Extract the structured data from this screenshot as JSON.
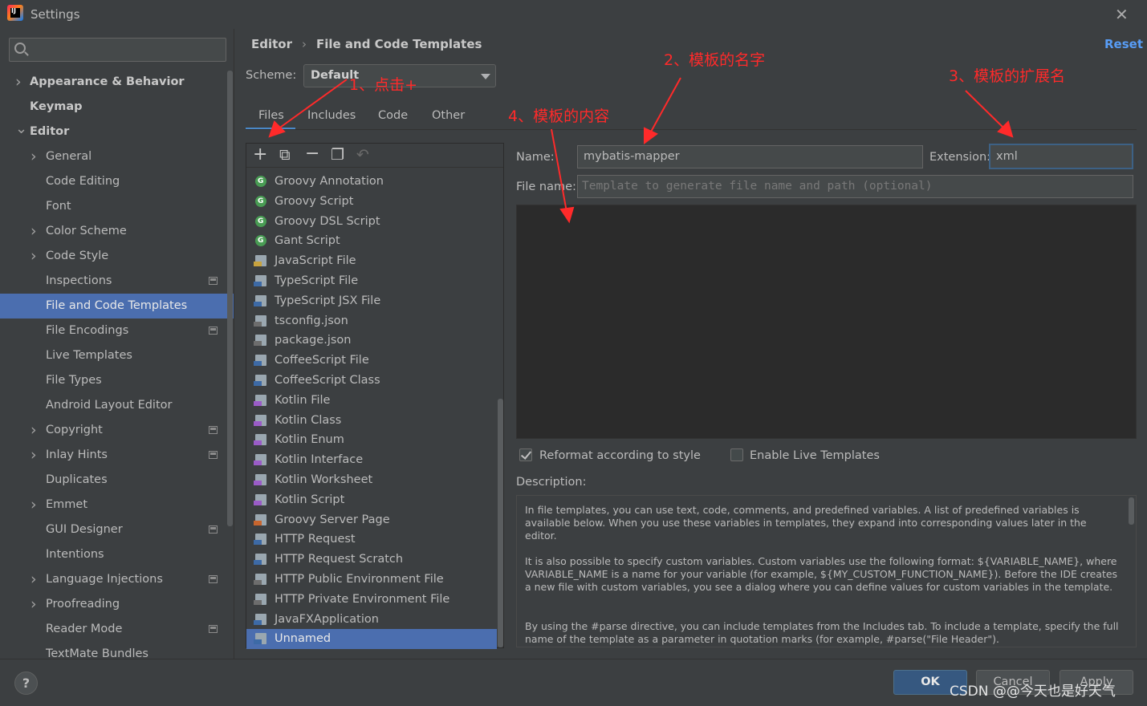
{
  "window": {
    "title": "Settings",
    "close_icon": "close-icon"
  },
  "search": {
    "placeholder": ""
  },
  "sidebar": {
    "items": [
      {
        "label": "Appearance & Behavior",
        "chevron": ">",
        "bold": true
      },
      {
        "label": "Keymap",
        "chevron": "",
        "bold": true
      },
      {
        "label": "Editor",
        "chevron": "v",
        "bold": true
      },
      {
        "label": "General",
        "chevron": ">"
      },
      {
        "label": "Code Editing",
        "chevron": ""
      },
      {
        "label": "Font",
        "chevron": ""
      },
      {
        "label": "Color Scheme",
        "chevron": ">"
      },
      {
        "label": "Code Style",
        "chevron": ">"
      },
      {
        "label": "Inspections",
        "chevron": "",
        "mark": true
      },
      {
        "label": "File and Code Templates",
        "chevron": "",
        "selected": true
      },
      {
        "label": "File Encodings",
        "chevron": "",
        "mark": true
      },
      {
        "label": "Live Templates",
        "chevron": ""
      },
      {
        "label": "File Types",
        "chevron": ""
      },
      {
        "label": "Android Layout Editor",
        "chevron": ""
      },
      {
        "label": "Copyright",
        "chevron": ">",
        "mark": true
      },
      {
        "label": "Inlay Hints",
        "chevron": ">",
        "mark": true
      },
      {
        "label": "Duplicates",
        "chevron": ""
      },
      {
        "label": "Emmet",
        "chevron": ">"
      },
      {
        "label": "GUI Designer",
        "chevron": "",
        "mark": true
      },
      {
        "label": "Intentions",
        "chevron": ""
      },
      {
        "label": "Language Injections",
        "chevron": ">",
        "mark": true
      },
      {
        "label": "Proofreading",
        "chevron": ">"
      },
      {
        "label": "Reader Mode",
        "chevron": "",
        "mark": true
      },
      {
        "label": "TextMate Bundles",
        "chevron": ""
      }
    ]
  },
  "breadcrumb": {
    "parent": "Editor",
    "current": "File and Code Templates",
    "separator": "›"
  },
  "reset_label": "Reset",
  "scheme": {
    "label": "Scheme:",
    "value": "Default"
  },
  "tabs": [
    {
      "label": "Files",
      "active": true
    },
    {
      "label": "Includes"
    },
    {
      "label": "Code"
    },
    {
      "label": "Other"
    }
  ],
  "toolbar": {
    "add": "+",
    "copy": "⧉",
    "remove": "−",
    "duplicate": "❐",
    "revert": "↶"
  },
  "templates": [
    {
      "label": "Groovy Annotation",
      "icon": "groovy-icon"
    },
    {
      "label": "Groovy Script",
      "icon": "groovy-icon"
    },
    {
      "label": "Groovy DSL Script",
      "icon": "groovy-icon"
    },
    {
      "label": "Gant Script",
      "icon": "groovy-icon"
    },
    {
      "label": "JavaScript File",
      "icon": "js-file-icon",
      "color": "#c7a23e"
    },
    {
      "label": "TypeScript File",
      "icon": "ts-file-icon",
      "color": "#3d6aa6"
    },
    {
      "label": "TypeScript JSX File",
      "icon": "tsx-file-icon",
      "color": "#3d6aa6"
    },
    {
      "label": "tsconfig.json",
      "icon": "json-file-icon",
      "color": "#6d6d6d"
    },
    {
      "label": "package.json",
      "icon": "json-file-icon",
      "color": "#6d6d6d"
    },
    {
      "label": "CoffeeScript File",
      "icon": "coffee-file-icon",
      "color": "#3d6aa6"
    },
    {
      "label": "CoffeeScript Class",
      "icon": "coffee-file-icon",
      "color": "#3d6aa6"
    },
    {
      "label": "Kotlin File",
      "icon": "kotlin-file-icon",
      "color": "#9a5cc7"
    },
    {
      "label": "Kotlin Class",
      "icon": "kotlin-file-icon",
      "color": "#9a5cc7"
    },
    {
      "label": "Kotlin Enum",
      "icon": "kotlin-file-icon",
      "color": "#9a5cc7"
    },
    {
      "label": "Kotlin Interface",
      "icon": "kotlin-file-icon",
      "color": "#9a5cc7"
    },
    {
      "label": "Kotlin Worksheet",
      "icon": "kotlin-file-icon",
      "color": "#9a5cc7"
    },
    {
      "label": "Kotlin Script",
      "icon": "kotlin-file-icon",
      "color": "#9a5cc7"
    },
    {
      "label": "Groovy Server Page",
      "icon": "gsp-file-icon",
      "color": "#c7652e"
    },
    {
      "label": "HTTP Request",
      "icon": "api-file-icon",
      "color": "#3d6aa6"
    },
    {
      "label": "HTTP Request Scratch",
      "icon": "api-file-icon",
      "color": "#3d6aa6"
    },
    {
      "label": "HTTP Public Environment File",
      "icon": "json-file-icon",
      "color": "#6d6d6d"
    },
    {
      "label": "HTTP Private Environment File",
      "icon": "json-file-icon",
      "color": "#6d6d6d"
    },
    {
      "label": "JavaFXApplication",
      "icon": "java-file-icon",
      "color": "#3d6aa6"
    },
    {
      "label": "Unnamed",
      "icon": "file-icon",
      "color": "#3d6aa6",
      "selected": true
    }
  ],
  "form": {
    "name_label": "Name:",
    "name_value": "mybatis-mapper",
    "extension_label": "Extension:",
    "extension_value": "xml",
    "filename_label": "File name:",
    "filename_placeholder": "Template to generate file name and path (optional)",
    "reformat_label": "Reformat according to style",
    "reformat_checked": true,
    "live_templates_label": "Enable Live Templates",
    "live_templates_checked": false,
    "description_label": "Description:"
  },
  "description": {
    "p1": "In file templates, you can use text, code, comments, and predefined variables. A list of predefined variables is available below. When you use these variables in templates, they expand into corresponding values later in the editor.",
    "p2": "It is also possible to specify custom variables. Custom variables use the following format: ${VARIABLE_NAME}, where VARIABLE_NAME is a name for your variable (for example, ${MY_CUSTOM_FUNCTION_NAME}). Before the IDE creates a new file with custom variables, you see a dialog where you can define values for custom variables in the template.",
    "p3": "By using the #parse directive, you can include templates from the Includes tab. To include a template, specify the full name of the template as a parameter in quotation marks (for example, #parse(\"File Header\")."
  },
  "buttons": {
    "ok": "OK",
    "cancel": "Cancel",
    "apply": "Apply",
    "help": "?"
  },
  "annotations": {
    "a1": "1、点击+",
    "a2": "2、模板的名字",
    "a3": "3、模板的扩展名",
    "a4": "4、模板的内容",
    "color": "#ff2a2a"
  },
  "watermark": "CSDN @@今天也是好天气"
}
